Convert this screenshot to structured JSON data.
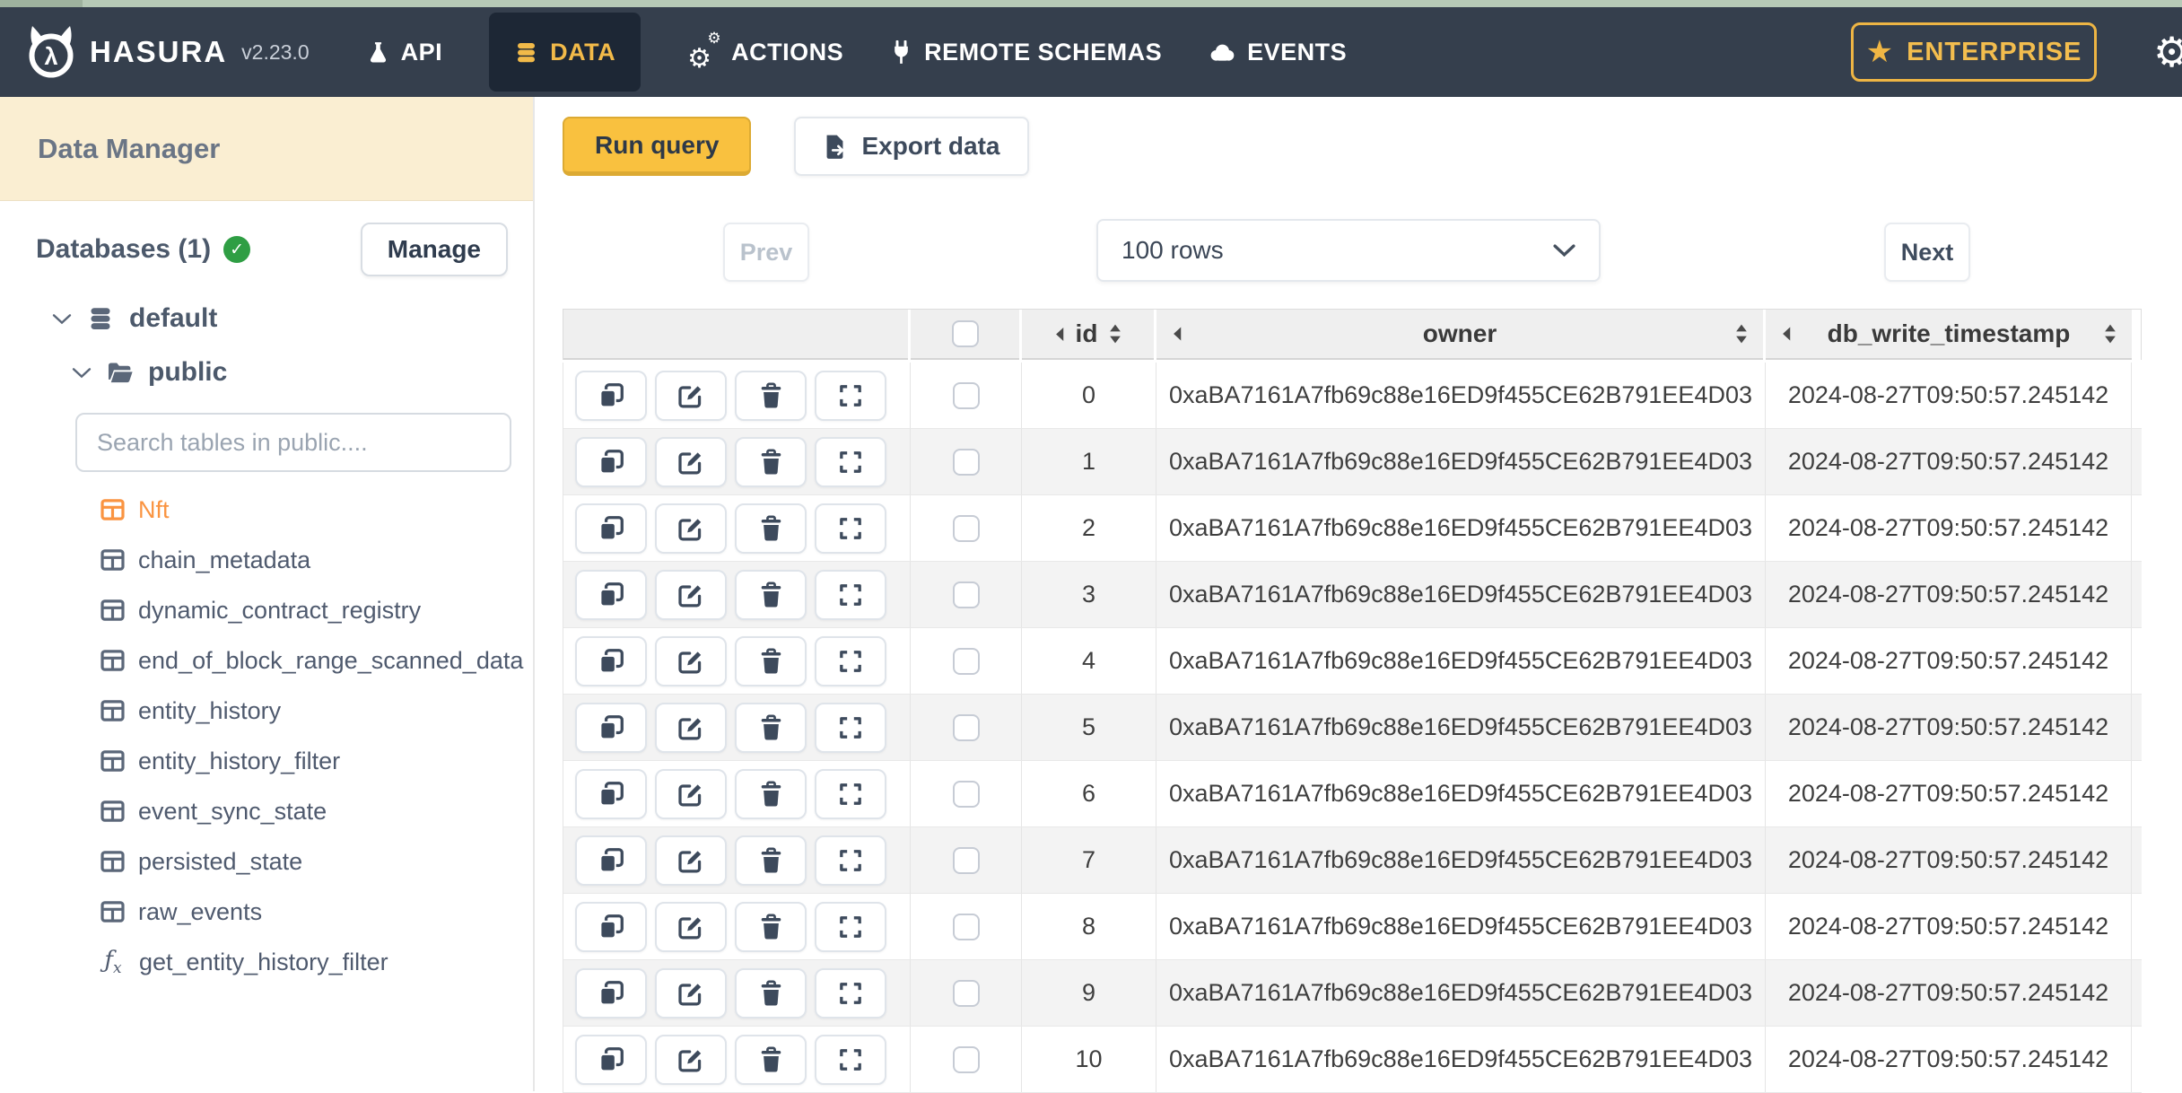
{
  "topbar": {
    "brand": "HASURA",
    "version": "v2.23.0",
    "nav": [
      {
        "label": "API",
        "icon": "flask-icon"
      },
      {
        "label": "DATA",
        "icon": "database-icon",
        "active": true
      },
      {
        "label": "ACTIONS",
        "icon": "gears-icon"
      },
      {
        "label": "REMOTE SCHEMAS",
        "icon": "plug-icon"
      },
      {
        "label": "EVENTS",
        "icon": "cloud-icon"
      }
    ],
    "enterprise_label": "ENTERPRISE"
  },
  "sidebar": {
    "title": "Data Manager",
    "databases_label": "Databases (1)",
    "manage_label": "Manage",
    "tree": {
      "database": "default",
      "schema": "public"
    },
    "search_placeholder": "Search tables in public....",
    "items": [
      {
        "label": "Nft",
        "type": "table",
        "active": true
      },
      {
        "label": "chain_metadata",
        "type": "table"
      },
      {
        "label": "dynamic_contract_registry",
        "type": "table"
      },
      {
        "label": "end_of_block_range_scanned_data",
        "type": "table"
      },
      {
        "label": "entity_history",
        "type": "table"
      },
      {
        "label": "entity_history_filter",
        "type": "table"
      },
      {
        "label": "event_sync_state",
        "type": "table"
      },
      {
        "label": "persisted_state",
        "type": "table"
      },
      {
        "label": "raw_events",
        "type": "table"
      },
      {
        "label": "get_entity_history_filter",
        "type": "function"
      }
    ]
  },
  "toolbar": {
    "run_query_label": "Run query",
    "export_data_label": "Export data"
  },
  "pagination": {
    "prev_label": "Prev",
    "rows_value": "100 rows",
    "next_label": "Next"
  },
  "grid": {
    "columns": [
      {
        "name": "id"
      },
      {
        "name": "owner"
      },
      {
        "name": "db_write_timestamp"
      }
    ],
    "rows": [
      {
        "id": "0",
        "owner": "0xaBA7161A7fb69c88e16ED9f455CE62B791EE4D03",
        "db_write_timestamp": "2024-08-27T09:50:57.245142"
      },
      {
        "id": "1",
        "owner": "0xaBA7161A7fb69c88e16ED9f455CE62B791EE4D03",
        "db_write_timestamp": "2024-08-27T09:50:57.245142"
      },
      {
        "id": "2",
        "owner": "0xaBA7161A7fb69c88e16ED9f455CE62B791EE4D03",
        "db_write_timestamp": "2024-08-27T09:50:57.245142"
      },
      {
        "id": "3",
        "owner": "0xaBA7161A7fb69c88e16ED9f455CE62B791EE4D03",
        "db_write_timestamp": "2024-08-27T09:50:57.245142"
      },
      {
        "id": "4",
        "owner": "0xaBA7161A7fb69c88e16ED9f455CE62B791EE4D03",
        "db_write_timestamp": "2024-08-27T09:50:57.245142"
      },
      {
        "id": "5",
        "owner": "0xaBA7161A7fb69c88e16ED9f455CE62B791EE4D03",
        "db_write_timestamp": "2024-08-27T09:50:57.245142"
      },
      {
        "id": "6",
        "owner": "0xaBA7161A7fb69c88e16ED9f455CE62B791EE4D03",
        "db_write_timestamp": "2024-08-27T09:50:57.245142"
      },
      {
        "id": "7",
        "owner": "0xaBA7161A7fb69c88e16ED9f455CE62B791EE4D03",
        "db_write_timestamp": "2024-08-27T09:50:57.245142"
      },
      {
        "id": "8",
        "owner": "0xaBA7161A7fb69c88e16ED9f455CE62B791EE4D03",
        "db_write_timestamp": "2024-08-27T09:50:57.245142"
      },
      {
        "id": "9",
        "owner": "0xaBA7161A7fb69c88e16ED9f455CE62B791EE4D03",
        "db_write_timestamp": "2024-08-27T09:50:57.245142"
      },
      {
        "id": "10",
        "owner": "0xaBA7161A7fb69c88e16ED9f455CE62B791EE4D03",
        "db_write_timestamp": "2024-08-27T09:50:57.245142"
      }
    ]
  },
  "colors": {
    "navbar_bg": "#353f4d",
    "brand_yellow": "#f2ba49",
    "active_table_orange": "#fa9441",
    "status_green": "#2f9e44",
    "run_query_yellow": "#f9c13f",
    "sidebar_header_cream": "#faeed2",
    "top_strip_green": "#b6c9b6"
  }
}
